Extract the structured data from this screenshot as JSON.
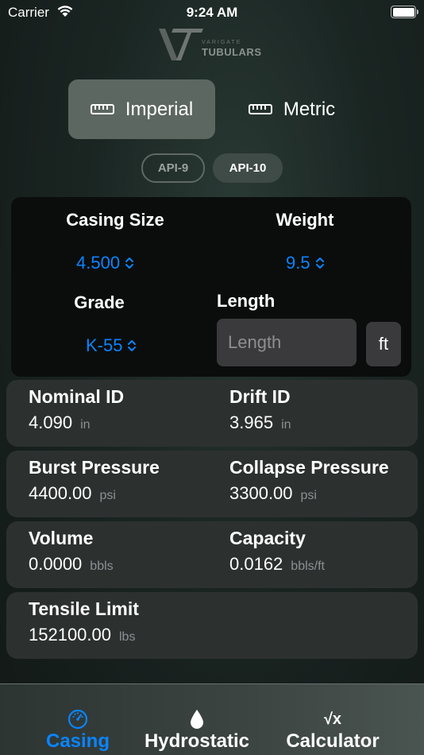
{
  "status_bar": {
    "carrier": "Carrier",
    "time": "9:24 AM"
  },
  "logo": {
    "small": "VARIGATE",
    "big": "TUBULARS"
  },
  "units": {
    "imperial": "Imperial",
    "metric": "Metric",
    "selected": "Imperial"
  },
  "standards": {
    "api9": "API-9",
    "api10": "API-10",
    "selected": "API-10"
  },
  "inputs": {
    "casing_size": {
      "label": "Casing Size",
      "value": "4.500"
    },
    "weight": {
      "label": "Weight",
      "value": "9.5"
    },
    "grade": {
      "label": "Grade",
      "value": "K-55"
    },
    "length": {
      "label": "Length",
      "placeholder": "Length",
      "value": "",
      "unit": "ft"
    }
  },
  "results": {
    "nominal_id": {
      "label": "Nominal ID",
      "value": "4.090",
      "unit": "in"
    },
    "drift_id": {
      "label": "Drift ID",
      "value": "3.965",
      "unit": "in"
    },
    "burst_pressure": {
      "label": "Burst Pressure",
      "value": "4400.00",
      "unit": "psi"
    },
    "collapse_pressure": {
      "label": "Collapse Pressure",
      "value": "3300.00",
      "unit": "psi"
    },
    "volume": {
      "label": "Volume",
      "value": "0.0000",
      "unit": "bbls"
    },
    "capacity": {
      "label": "Capacity",
      "value": "0.0162",
      "unit": "bbls/ft"
    },
    "tensile_limit": {
      "label": "Tensile Limit",
      "value": "152100.00",
      "unit": "lbs"
    }
  },
  "tabs": {
    "casing": "Casing",
    "hydrostatic": "Hydrostatic",
    "calculator": "Calculator",
    "calculator_icon": "√x",
    "active": "Casing"
  },
  "colors": {
    "accent": "#0a84ff",
    "active_segment": "#5d6762",
    "card": "#2c3130"
  }
}
